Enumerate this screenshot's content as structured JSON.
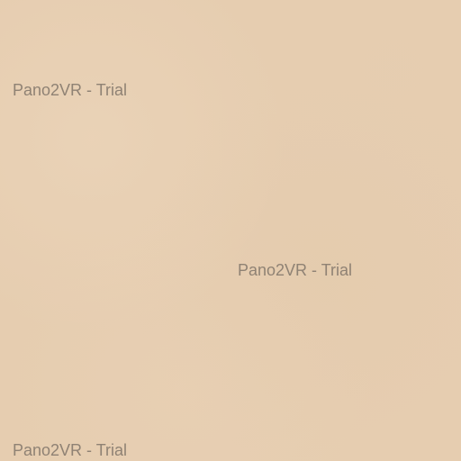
{
  "background": {
    "color": "#e6cdb0"
  },
  "watermarks": [
    {
      "text": "Pano2VR - Trial"
    },
    {
      "text": "Pano2VR - Trial"
    },
    {
      "text": "Pano2VR - Trial"
    }
  ],
  "colors": {
    "watermark_text": "#8f8274"
  }
}
